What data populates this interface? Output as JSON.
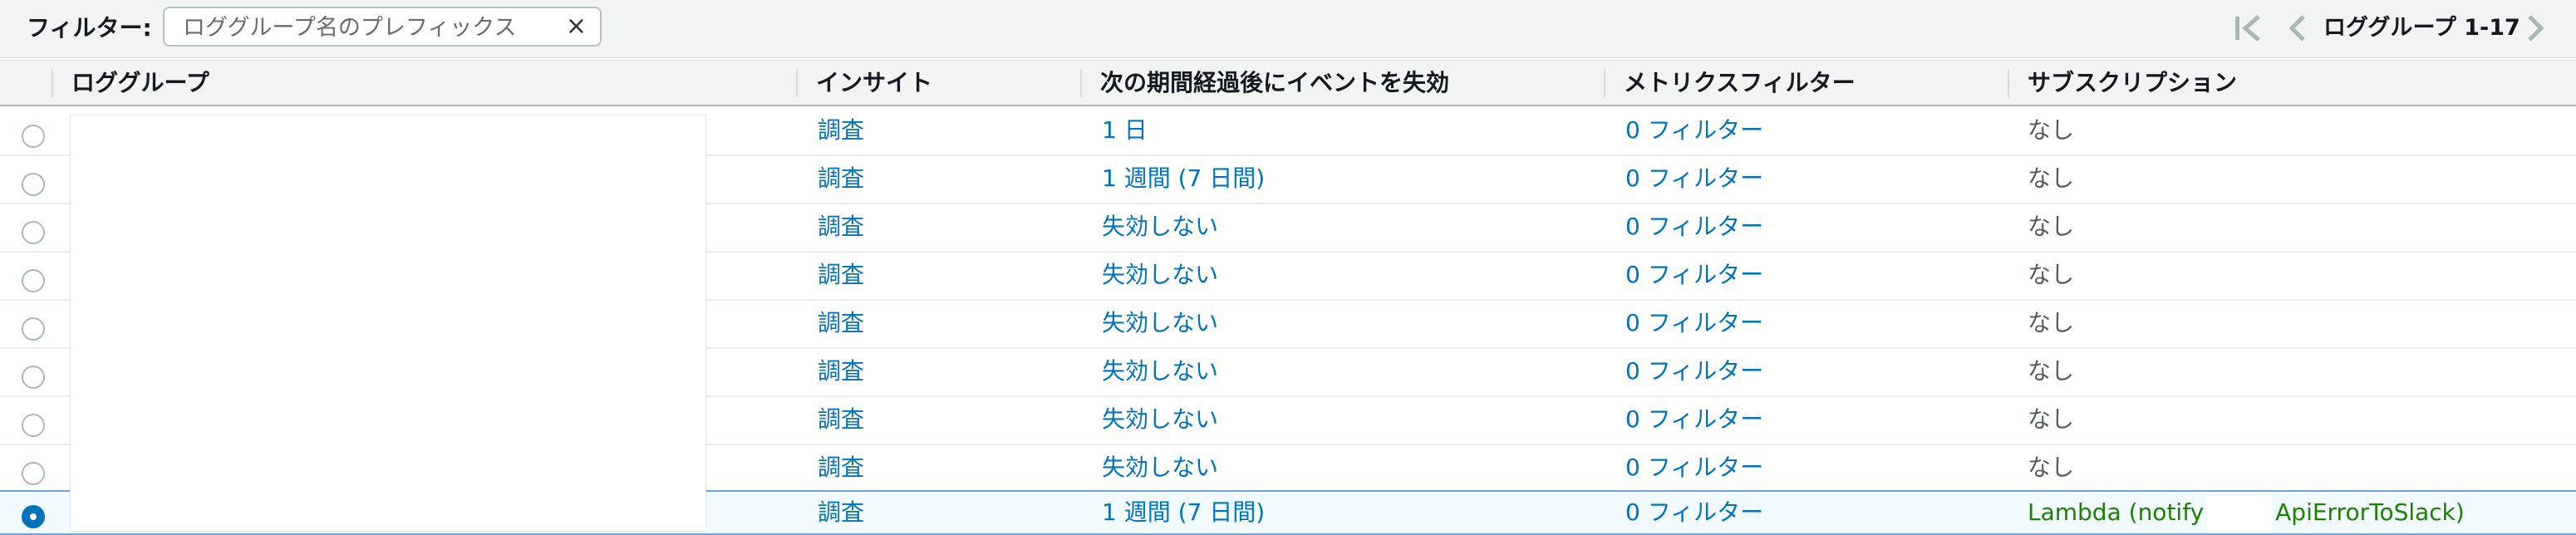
{
  "toolbar": {
    "filter_label": "フィルター:",
    "filter_placeholder": "ロググループ名のプレフィックス",
    "clear_symbol": "×",
    "pager_text": "ロググループ 1-17"
  },
  "table": {
    "columns": [
      "ロググループ",
      "インサイト",
      "次の期間経過後にイベントを失効",
      "メトリクスフィルター",
      "サブスクリプション"
    ],
    "rows": [
      {
        "insights": "調査",
        "expiry": "1 日",
        "metric": "0 フィルター",
        "subscription": "なし",
        "selected": false
      },
      {
        "insights": "調査",
        "expiry": "1 週間 (7 日間)",
        "metric": "0 フィルター",
        "subscription": "なし",
        "selected": false
      },
      {
        "insights": "調査",
        "expiry": "失効しない",
        "metric": "0 フィルター",
        "subscription": "なし",
        "selected": false
      },
      {
        "insights": "調査",
        "expiry": "失効しない",
        "metric": "0 フィルター",
        "subscription": "なし",
        "selected": false
      },
      {
        "insights": "調査",
        "expiry": "失効しない",
        "metric": "0 フィルター",
        "subscription": "なし",
        "selected": false
      },
      {
        "insights": "調査",
        "expiry": "失効しない",
        "metric": "0 フィルター",
        "subscription": "なし",
        "selected": false
      },
      {
        "insights": "調査",
        "expiry": "失効しない",
        "metric": "0 フィルター",
        "subscription": "なし",
        "selected": false
      },
      {
        "insights": "調査",
        "expiry": "失効しない",
        "metric": "0 フィルター",
        "subscription": "なし",
        "selected": false
      },
      {
        "insights": "調査",
        "expiry": "1 週間 (7 日間)",
        "metric": "0 フィルター",
        "subscription_prefix": "Lambda (notify",
        "subscription_suffix": "ApiErrorToSlack)",
        "selected": true
      }
    ]
  },
  "colors": {
    "link": "#0073bb",
    "subscription_lambda": "#1d8102",
    "selected_row": "#f1faff"
  },
  "icons": {
    "first_page": "first-page-icon",
    "prev_page": "chevron-left-icon",
    "next_page": "chevron-right-icon",
    "clear": "close-icon"
  }
}
